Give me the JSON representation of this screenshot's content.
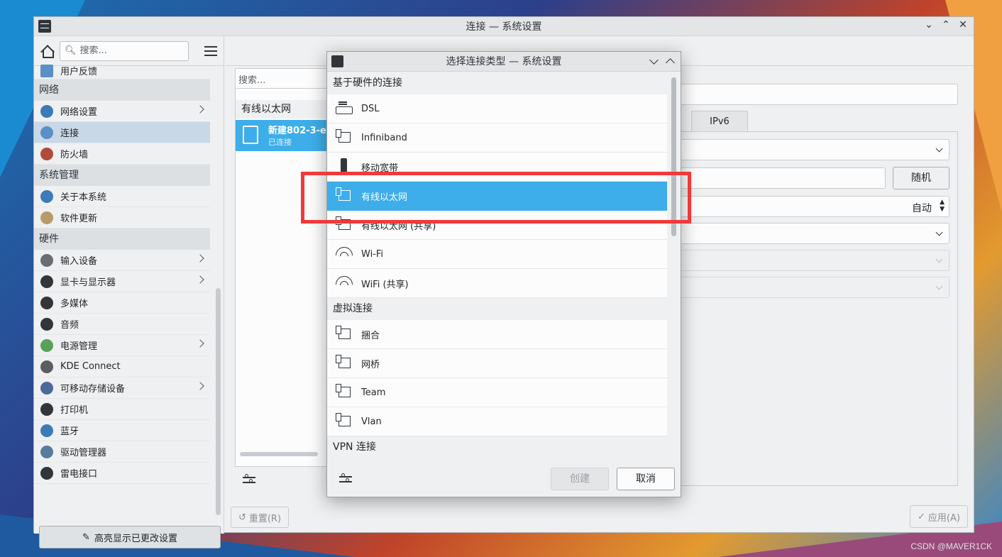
{
  "main_window": {
    "title": "连接 — 系统设置",
    "controls": {
      "minimize": "⌄",
      "maximize": "⌃",
      "close": "✕"
    }
  },
  "sidebar": {
    "search_placeholder": "搜索...",
    "partial_item": "用户反馈",
    "sections": [
      {
        "category": "网络",
        "items": [
          {
            "label": "网络设置",
            "arrow": true
          },
          {
            "label": "连接",
            "selected": true
          },
          {
            "label": "防火墙"
          }
        ]
      },
      {
        "category": "系统管理",
        "items": [
          {
            "label": "关于本系统"
          },
          {
            "label": "软件更新"
          }
        ]
      },
      {
        "category": "硬件",
        "items": [
          {
            "label": "输入设备",
            "arrow": true
          },
          {
            "label": "显卡与显示器",
            "arrow": true
          },
          {
            "label": "多媒体"
          },
          {
            "label": "音频"
          },
          {
            "label": "电源管理",
            "arrow": true
          },
          {
            "label": "KDE Connect"
          },
          {
            "label": "可移动存储设备",
            "arrow": true
          },
          {
            "label": "打印机"
          },
          {
            "label": "蓝牙"
          },
          {
            "label": "驱动管理器"
          },
          {
            "label": "雷电接口"
          }
        ]
      }
    ],
    "highlight_button": "高亮显示已更改设置"
  },
  "connections": {
    "search_placeholder": "搜索...",
    "group_label": "有线以太网",
    "item_name": "新建802-3-eth",
    "item_status": "已连接"
  },
  "details": {
    "tab_ipv6": "IPv6",
    "random_button": "随机",
    "mtu_value": "自动"
  },
  "footer": {
    "reset_button": "重置(R)",
    "apply_button": "应用(A)"
  },
  "dialog": {
    "title": "选择连接类型 — 系统设置",
    "groups": [
      {
        "label": "基于硬件的连接",
        "options": [
          {
            "label": "DSL",
            "icon": "dsl"
          },
          {
            "label": "Infiniband",
            "icon": "net"
          },
          {
            "label": "移动宽带",
            "icon": "mobile"
          },
          {
            "label": "有线以太网",
            "icon": "net",
            "selected": true
          },
          {
            "label": "有线以太网 (共享)",
            "icon": "net"
          },
          {
            "label": "Wi-Fi",
            "icon": "wifi"
          },
          {
            "label": "WiFi (共享)",
            "icon": "wifi"
          }
        ]
      },
      {
        "label": "虚拟连接",
        "options": [
          {
            "label": "捆合",
            "icon": "net"
          },
          {
            "label": "网桥",
            "icon": "net"
          },
          {
            "label": "Team",
            "icon": "net"
          },
          {
            "label": "Vlan",
            "icon": "net"
          }
        ]
      },
      {
        "label": "VPN 连接",
        "options": []
      }
    ],
    "create_button": "创建",
    "cancel_button": "取消"
  },
  "watermark": "CSDN @MAVER1CK",
  "colors": {
    "accent": "#3daee9",
    "highlight_box": "#f03a3a",
    "selection_sidebar": "#c9d8e7"
  }
}
